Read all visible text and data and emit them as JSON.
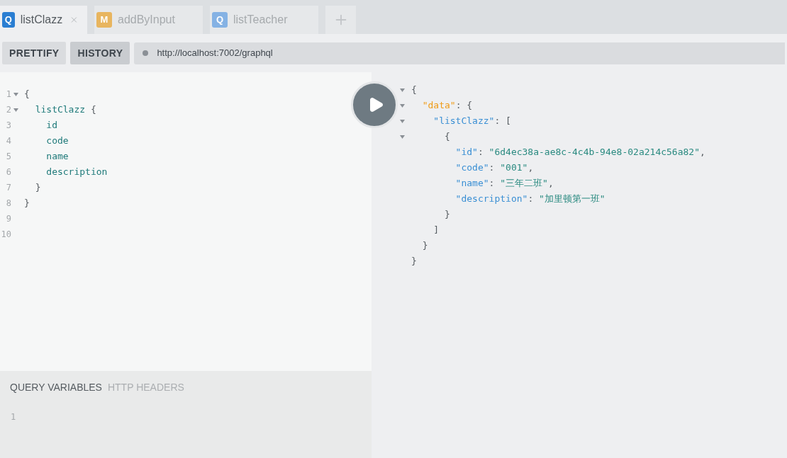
{
  "tabs": [
    {
      "badge": "Q",
      "color": "#2a7ed2",
      "label": "listClazz",
      "selected": true,
      "closable": true
    },
    {
      "badge": "M",
      "color": "#e8b55f",
      "label": "addByInput",
      "selected": false,
      "closable": false
    },
    {
      "badge": "Q",
      "color": "#85b2e4",
      "label": "listTeacher",
      "selected": false,
      "closable": false
    }
  ],
  "toolbar": {
    "buttons": [
      {
        "label": "PRETTIFY",
        "selected": false
      },
      {
        "label": "HISTORY",
        "selected": true
      }
    ],
    "url": "http://localhost:7002/graphql"
  },
  "query_editor": {
    "lines": [
      {
        "number": "1",
        "foldable": true,
        "tokens": [
          {
            "kind": "punct",
            "text": "{"
          }
        ]
      },
      {
        "number": "2",
        "foldable": true,
        "tokens": [
          {
            "kind": "field",
            "text": "  listClazz"
          },
          {
            "kind": "punct",
            "text": " {"
          }
        ]
      },
      {
        "number": "3",
        "foldable": false,
        "tokens": [
          {
            "kind": "field",
            "text": "    id"
          }
        ]
      },
      {
        "number": "4",
        "foldable": false,
        "tokens": [
          {
            "kind": "field",
            "text": "    code"
          }
        ]
      },
      {
        "number": "5",
        "foldable": false,
        "tokens": [
          {
            "kind": "field",
            "text": "    name"
          }
        ]
      },
      {
        "number": "6",
        "foldable": false,
        "tokens": [
          {
            "kind": "field",
            "text": "    description"
          }
        ]
      },
      {
        "number": "7",
        "foldable": false,
        "tokens": [
          {
            "kind": "punct",
            "text": "  }"
          }
        ]
      },
      {
        "number": "8",
        "foldable": false,
        "tokens": [
          {
            "kind": "punct",
            "text": "}"
          }
        ]
      },
      {
        "number": "9",
        "foldable": false
      },
      {
        "number": "10",
        "foldable": false
      }
    ]
  },
  "variables_panel": {
    "tabs": [
      {
        "label": "QUERY VARIABLES",
        "selected": true
      },
      {
        "label": "HTTP HEADERS",
        "selected": false
      }
    ],
    "lines": [
      {
        "number": "1"
      }
    ]
  },
  "result": {
    "lines": [
      {
        "foldable": true,
        "tokens": [
          {
            "kind": "punct",
            "text": "{"
          }
        ]
      },
      {
        "foldable": true,
        "tokens": [
          {
            "kind": "root-key",
            "text": "  \"data\""
          },
          {
            "kind": "punct",
            "text": ": {"
          }
        ]
      },
      {
        "foldable": true,
        "tokens": [
          {
            "kind": "key",
            "text": "    \"listClazz\""
          },
          {
            "kind": "punct",
            "text": ": ["
          }
        ]
      },
      {
        "foldable": true,
        "tokens": [
          {
            "kind": "punct",
            "text": "      {"
          }
        ]
      },
      {
        "foldable": false,
        "tokens": [
          {
            "kind": "key",
            "text": "        \"id\""
          },
          {
            "kind": "punct",
            "text": ": "
          },
          {
            "kind": "string",
            "text": "\"6d4ec38a-ae8c-4c4b-94e8-02a214c56a82\""
          },
          {
            "kind": "punct",
            "text": ","
          }
        ]
      },
      {
        "foldable": false,
        "tokens": [
          {
            "kind": "key",
            "text": "        \"code\""
          },
          {
            "kind": "punct",
            "text": ": "
          },
          {
            "kind": "string",
            "text": "\"001\""
          },
          {
            "kind": "punct",
            "text": ","
          }
        ]
      },
      {
        "foldable": false,
        "tokens": [
          {
            "kind": "key",
            "text": "        \"name\""
          },
          {
            "kind": "punct",
            "text": ": "
          },
          {
            "kind": "string",
            "text": "\"三年二班\""
          },
          {
            "kind": "punct",
            "text": ","
          }
        ]
      },
      {
        "foldable": false,
        "tokens": [
          {
            "kind": "key",
            "text": "        \"description\""
          },
          {
            "kind": "punct",
            "text": ": "
          },
          {
            "kind": "string",
            "text": "\"加里顿第一班\""
          }
        ]
      },
      {
        "foldable": false,
        "tokens": [
          {
            "kind": "punct",
            "text": "      }"
          }
        ]
      },
      {
        "foldable": false,
        "tokens": [
          {
            "kind": "punct",
            "text": "    ]"
          }
        ]
      },
      {
        "foldable": false,
        "tokens": [
          {
            "kind": "punct",
            "text": "  }"
          }
        ]
      },
      {
        "foldable": false,
        "tokens": [
          {
            "kind": "punct",
            "text": "}"
          }
        ]
      }
    ]
  }
}
